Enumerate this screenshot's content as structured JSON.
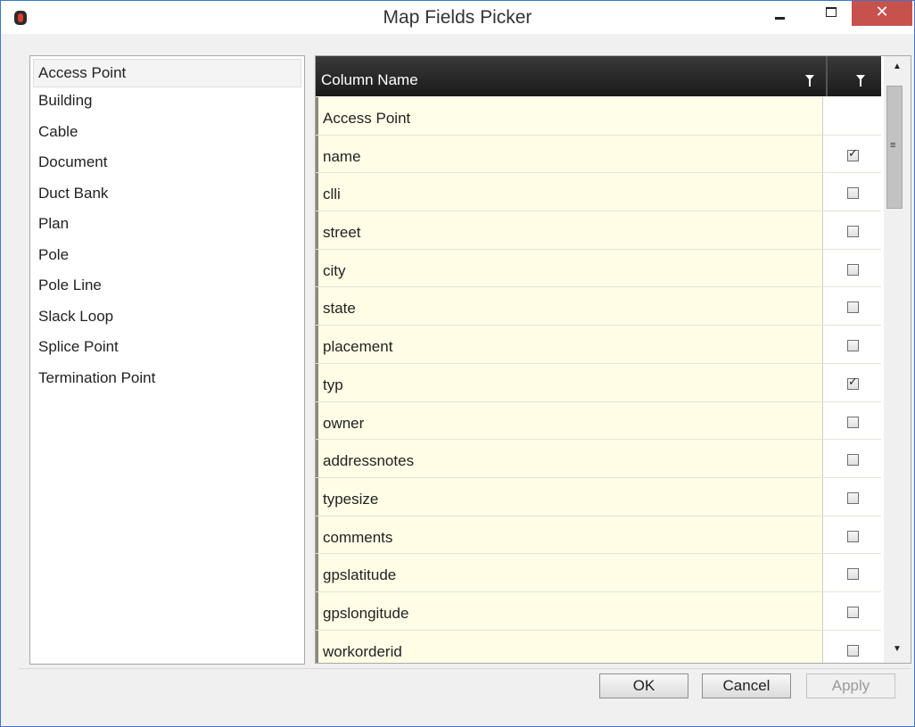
{
  "window": {
    "title": "Map Fields Picker",
    "close_glyph": "✕"
  },
  "left_list": {
    "items": [
      "Access Point",
      "Building",
      "Cable",
      "Document",
      "Duct Bank",
      "Plan",
      "Pole",
      "Pole Line",
      "Slack Loop",
      "Splice Point",
      "Termination Point"
    ],
    "selected": "Access Point"
  },
  "grid": {
    "header": {
      "column_name": "Column Name"
    },
    "rows": [
      {
        "name": "Access Point",
        "group": true
      },
      {
        "name": "name",
        "checked": true
      },
      {
        "name": "clli",
        "checked": false
      },
      {
        "name": "street",
        "checked": false
      },
      {
        "name": "city",
        "checked": false
      },
      {
        "name": "state",
        "checked": false
      },
      {
        "name": "placement",
        "checked": false
      },
      {
        "name": "typ",
        "checked": true
      },
      {
        "name": "owner",
        "checked": false
      },
      {
        "name": "addressnotes",
        "checked": false
      },
      {
        "name": "typesize",
        "checked": false
      },
      {
        "name": "comments",
        "checked": false
      },
      {
        "name": "gpslatitude",
        "checked": false
      },
      {
        "name": "gpslongitude",
        "checked": false
      },
      {
        "name": "workorderid",
        "checked": false
      }
    ]
  },
  "buttons": {
    "ok": "OK",
    "cancel": "Cancel",
    "apply": "Apply"
  },
  "icons": {
    "app": "app-icon",
    "filter": "filter-icon",
    "minimize": "minimize-icon",
    "maximize": "maximize-icon",
    "close": "close-icon"
  },
  "colors": {
    "row_background": "#fffde6",
    "header_background": "#1a1a1a",
    "close_button": "#c7514b",
    "window_border": "#3c78c8"
  }
}
